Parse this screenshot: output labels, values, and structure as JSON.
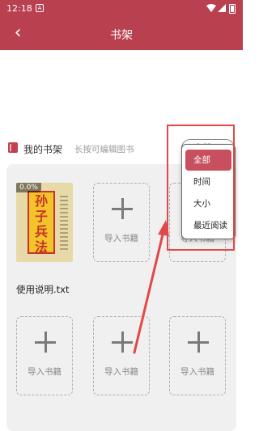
{
  "status_bar": {
    "time": "12:18",
    "notification_icon": "A"
  },
  "title_bar": {
    "back_glyph": "‹",
    "title": "书架"
  },
  "section": {
    "title": "我的书架",
    "hint": "长按可编辑图书",
    "filter_label": "全部 ︿"
  },
  "books": [
    {
      "name": "使用说明.txt",
      "progress": "0.0%",
      "cover_title": [
        "孙",
        "子",
        "兵",
        "法"
      ]
    }
  ],
  "import_label": "导入书籍",
  "dropdown": {
    "items": [
      {
        "label": "全部",
        "active": true
      },
      {
        "label": "时间",
        "active": false
      },
      {
        "label": "大小",
        "active": false
      },
      {
        "label": "最近阅读",
        "active": false
      }
    ]
  },
  "colors": {
    "brand": "#b8404f",
    "active_item": "#c8505e",
    "annotation": "#e24848"
  }
}
